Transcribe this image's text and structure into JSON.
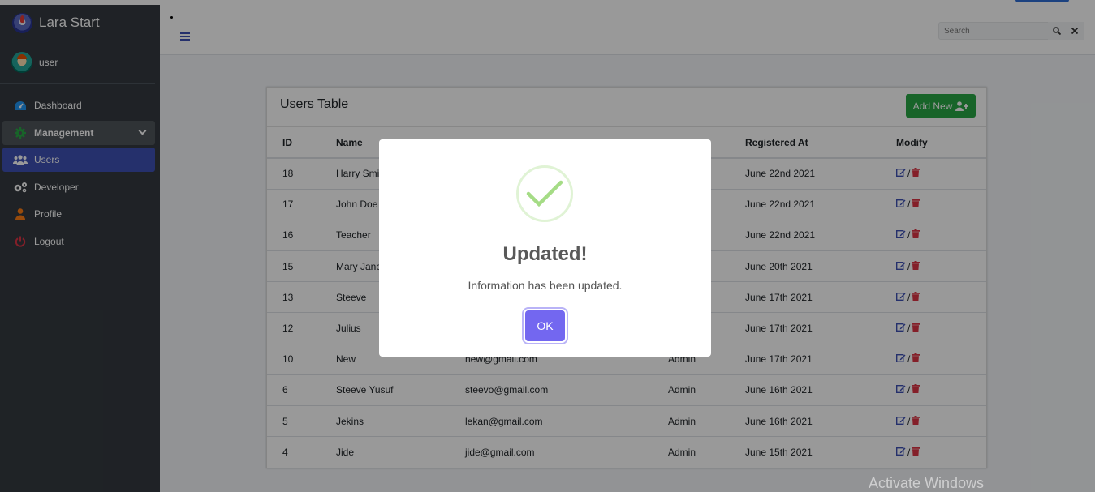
{
  "brand": {
    "name": "Lara Start"
  },
  "user": {
    "name": "user"
  },
  "sidebar": {
    "items": [
      {
        "label": "Dashboard"
      },
      {
        "label": "Management"
      },
      {
        "label": "Users"
      },
      {
        "label": "Developer"
      },
      {
        "label": "Profile"
      },
      {
        "label": "Logout"
      }
    ]
  },
  "search": {
    "placeholder": "Search"
  },
  "card": {
    "title": "Users Table",
    "add_label": "Add New"
  },
  "table": {
    "headers": [
      "ID",
      "Name",
      "Email",
      "Type",
      "Registered At",
      "Modify"
    ],
    "rows": [
      {
        "id": "18",
        "name": "Harry Smith",
        "email": "",
        "type": "",
        "registered": "June 22nd 2021"
      },
      {
        "id": "17",
        "name": "John Doe",
        "email": "",
        "type": "",
        "registered": "June 22nd 2021"
      },
      {
        "id": "16",
        "name": "Teacher",
        "email": "",
        "type": "",
        "registered": "June 22nd 2021"
      },
      {
        "id": "15",
        "name": "Mary Jane",
        "email": "",
        "type": "",
        "registered": "June 20th 2021"
      },
      {
        "id": "13",
        "name": "Steeve",
        "email": "",
        "type": "",
        "registered": "June 17th 2021"
      },
      {
        "id": "12",
        "name": "Julius",
        "email": "",
        "type": "",
        "registered": "June 17th 2021"
      },
      {
        "id": "10",
        "name": "New",
        "email": "new@gmail.com",
        "type": "Admin",
        "registered": "June 17th 2021"
      },
      {
        "id": "6",
        "name": "Steeve Yusuf",
        "email": "steevo@gmail.com",
        "type": "Admin",
        "registered": "June 16th 2021"
      },
      {
        "id": "5",
        "name": "Jekins",
        "email": "lekan@gmail.com",
        "type": "Admin",
        "registered": "June 16th 2021"
      },
      {
        "id": "4",
        "name": "Jide",
        "email": "jide@gmail.com",
        "type": "Admin",
        "registered": "June 15th 2021"
      }
    ],
    "separator": "/"
  },
  "modal": {
    "title": "Updated!",
    "text": "Information has been updated.",
    "ok_label": "OK"
  },
  "watermark": "Activate Windows",
  "colors": {
    "accent": "#3f51b5",
    "success": "#28a745",
    "ok": "#7367f0",
    "danger": "#dc3545"
  }
}
